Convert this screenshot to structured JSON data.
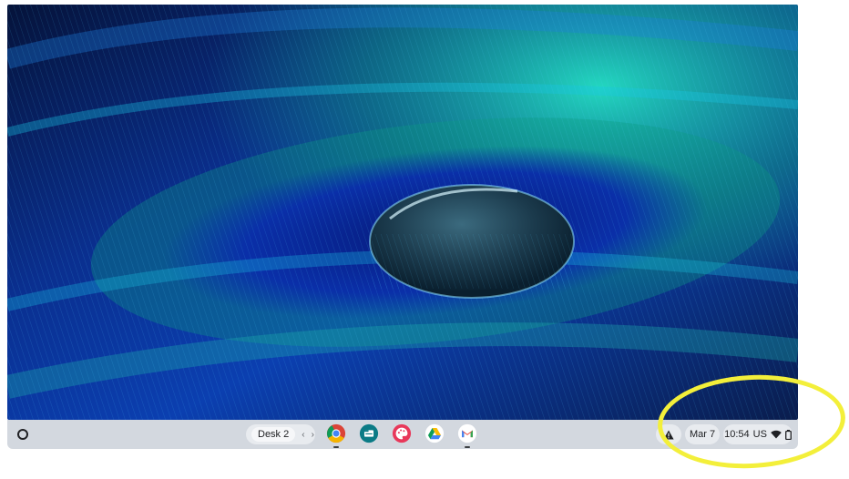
{
  "desktop": {
    "wallpaper": "peacock-feather-water-drop",
    "colors": {
      "deep_blue": "#0a2a8a",
      "teal": "#1bb0a8",
      "cyan": "#18c6e6",
      "green": "#0e8c72"
    }
  },
  "shelf": {
    "launcher_icon": "launcher-circle-icon",
    "desk": {
      "label": "Desk 2",
      "prev": "‹",
      "next": "›"
    },
    "apps": [
      {
        "name": "Chrome",
        "icon": "chrome-icon",
        "running": true
      },
      {
        "name": "Files",
        "icon": "files-icon",
        "running": false
      },
      {
        "name": "Canvas",
        "icon": "palette-icon",
        "running": false
      },
      {
        "name": "Google Drive",
        "icon": "drive-icon",
        "running": false
      },
      {
        "name": "Gmail",
        "icon": "gmail-icon",
        "running": true
      }
    ],
    "tray": {
      "notification_icon": "warning-icon",
      "date": "Mar 7",
      "time": "10:54",
      "ime": "US",
      "wifi_icon": "wifi-icon",
      "battery_icon": "battery-icon"
    }
  },
  "annotation": {
    "color": "#f3ef3a",
    "shape": "ellipse"
  }
}
